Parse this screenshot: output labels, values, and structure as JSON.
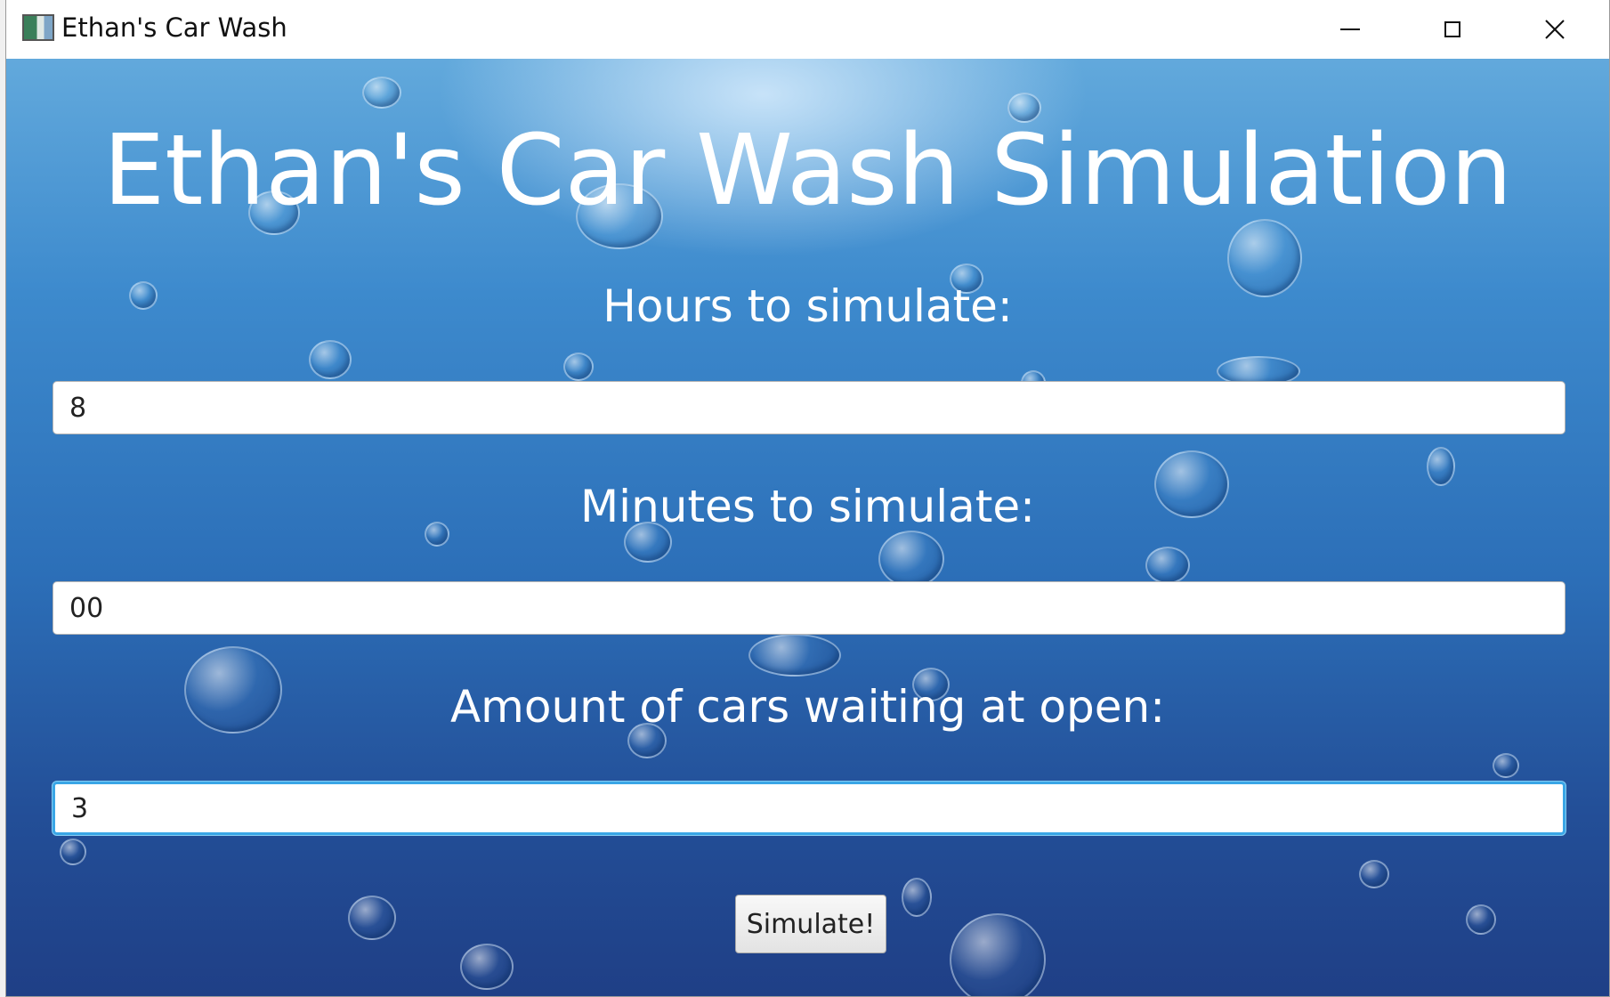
{
  "window": {
    "title": "Ethan's Car Wash",
    "controls": {
      "minimize": "minimize-icon",
      "maximize": "maximize-icon",
      "close": "close-icon"
    }
  },
  "main": {
    "heading": "Ethan's Car Wash Simulation",
    "hours": {
      "label": "Hours to simulate:",
      "value": "8"
    },
    "minutes": {
      "label": "Minutes to simulate:",
      "value": "00"
    },
    "cars": {
      "label": "Amount of cars waiting at open:",
      "value": "3"
    },
    "simulate_label": "Simulate!"
  },
  "colors": {
    "background_top": "#62a9dc",
    "background_bottom": "#1f3f86",
    "focus_ring": "#3aa6e6",
    "text": "#ffffff"
  }
}
